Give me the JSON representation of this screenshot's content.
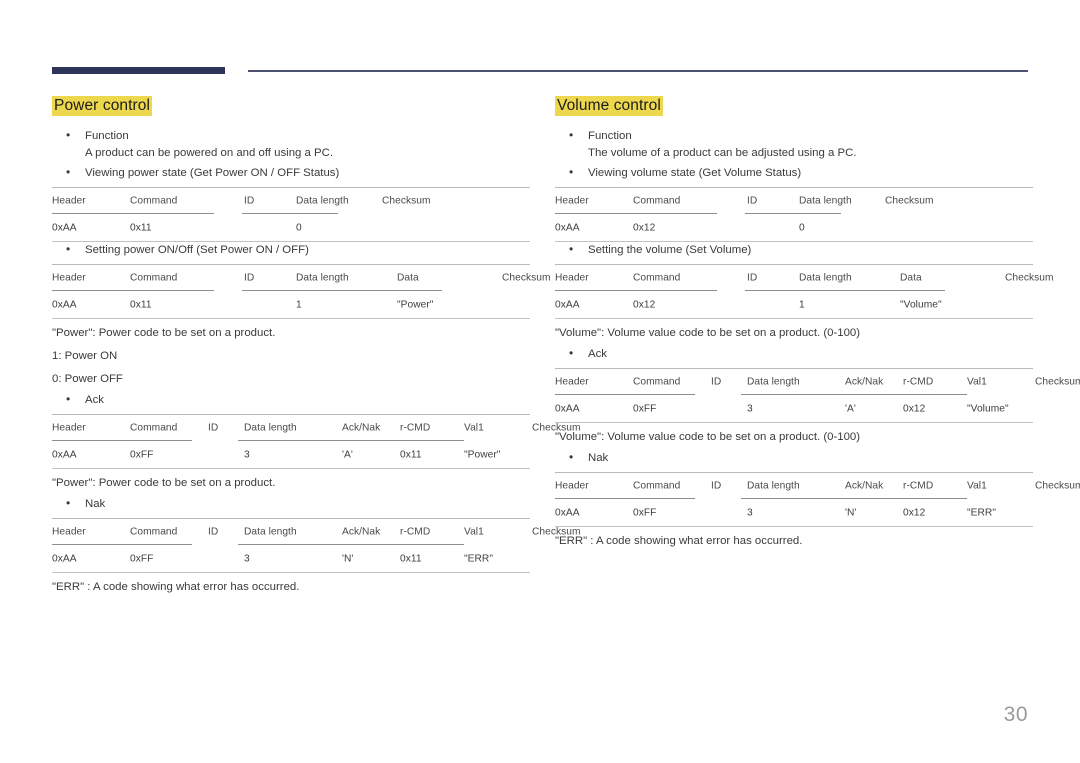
{
  "page": {
    "number": "30",
    "accent_bar_color": "#2c3559",
    "rule_color": "#4e5272",
    "highlight_color": "#edd74c"
  },
  "columns": [
    {
      "id": "power-control",
      "title": "Power control",
      "blocks": [
        {
          "kind": "bullet",
          "label": "Function",
          "sub": "A product can be powered on and off using a PC."
        },
        {
          "kind": "bullet",
          "label": "Viewing power state (Get Power ON / OFF Status)"
        },
        {
          "kind": "table",
          "id": "get-power-status",
          "layout": "get",
          "headers": [
            "Header",
            "Command",
            "ID",
            "Data length",
            "Checksum"
          ],
          "values": [
            "0xAA",
            "0x11",
            "",
            "0",
            ""
          ]
        },
        {
          "kind": "bullet",
          "label": "Setting power ON/Off (Set Power ON / OFF)"
        },
        {
          "kind": "table",
          "id": "set-power",
          "layout": "set",
          "headers": [
            "Header",
            "Command",
            "ID",
            "Data length",
            "Data",
            "Checksum"
          ],
          "values": [
            "0xAA",
            "0x11",
            "",
            "1",
            "\"Power\"",
            ""
          ]
        },
        {
          "kind": "note",
          "text": "\"Power\": Power code to be set on a product."
        },
        {
          "kind": "note",
          "text": "1: Power ON"
        },
        {
          "kind": "note",
          "text": "0: Power OFF"
        },
        {
          "kind": "bullet",
          "label": "Ack"
        },
        {
          "kind": "table",
          "id": "power-ack",
          "layout": "ack",
          "headers": [
            "Header",
            "Command",
            "ID",
            "Data length",
            "Ack/Nak",
            "r-CMD",
            "Val1",
            "Checksum"
          ],
          "values": [
            "0xAA",
            "0xFF",
            "",
            "3",
            "'A'",
            "0x11",
            "\"Power\"",
            ""
          ]
        },
        {
          "kind": "note",
          "text": "\"Power\": Power code to be set on a product."
        },
        {
          "kind": "bullet",
          "label": "Nak"
        },
        {
          "kind": "table",
          "id": "power-nak",
          "layout": "ack",
          "headers": [
            "Header",
            "Command",
            "ID",
            "Data length",
            "Ack/Nak",
            "r-CMD",
            "Val1",
            "Checksum"
          ],
          "values": [
            "0xAA",
            "0xFF",
            "",
            "3",
            "'N'",
            "0x11",
            "\"ERR\"",
            ""
          ]
        },
        {
          "kind": "note",
          "text": "\"ERR\" : A code showing what error has occurred."
        }
      ]
    },
    {
      "id": "volume-control",
      "title": "Volume control",
      "blocks": [
        {
          "kind": "bullet",
          "label": "Function",
          "sub": "The volume of a product can be adjusted using a PC."
        },
        {
          "kind": "bullet",
          "label": "Viewing volume state (Get Volume Status)"
        },
        {
          "kind": "table",
          "id": "get-volume-status",
          "layout": "get",
          "headers": [
            "Header",
            "Command",
            "ID",
            "Data length",
            "Checksum"
          ],
          "values": [
            "0xAA",
            "0x12",
            "",
            "0",
            ""
          ]
        },
        {
          "kind": "bullet",
          "label": "Setting the volume (Set Volume)"
        },
        {
          "kind": "table",
          "id": "set-volume",
          "layout": "set",
          "headers": [
            "Header",
            "Command",
            "ID",
            "Data length",
            "Data",
            "Checksum"
          ],
          "values": [
            "0xAA",
            "0x12",
            "",
            "1",
            "\"Volume\"",
            ""
          ]
        },
        {
          "kind": "note",
          "text": "\"Volume\": Volume value code to be set on a product. (0-100)"
        },
        {
          "kind": "bullet",
          "label": "Ack"
        },
        {
          "kind": "table",
          "id": "volume-ack",
          "layout": "ack",
          "headers": [
            "Header",
            "Command",
            "ID",
            "Data length",
            "Ack/Nak",
            "r-CMD",
            "Val1",
            "Checksum"
          ],
          "values": [
            "0xAA",
            "0xFF",
            "",
            "3",
            "'A'",
            "0x12",
            "\"Volume\"",
            ""
          ]
        },
        {
          "kind": "note",
          "text": "\"Volume\": Volume value code to be set on a product. (0-100)"
        },
        {
          "kind": "bullet",
          "label": "Nak"
        },
        {
          "kind": "table",
          "id": "volume-nak",
          "layout": "ack",
          "headers": [
            "Header",
            "Command",
            "ID",
            "Data length",
            "Ack/Nak",
            "r-CMD",
            "Val1",
            "Checksum"
          ],
          "values": [
            "0xAA",
            "0xFF",
            "",
            "3",
            "'N'",
            "0x12",
            "\"ERR\"",
            ""
          ]
        },
        {
          "kind": "note",
          "text": "\"ERR\" : A code showing what error has occurred."
        }
      ]
    }
  ],
  "layouts": {
    "get": {
      "cols": [
        0,
        78,
        192,
        244,
        330
      ],
      "segments": [
        [
          0,
          162
        ],
        [
          190,
          286
        ]
      ]
    },
    "set": {
      "cols": [
        0,
        78,
        192,
        244,
        345,
        450
      ],
      "segments": [
        [
          0,
          162
        ],
        [
          190,
          390
        ]
      ]
    },
    "ack": {
      "cols": [
        0,
        78,
        156,
        192,
        290,
        348,
        412,
        480
      ],
      "segments": [
        [
          0,
          140
        ],
        [
          186,
          412
        ]
      ]
    }
  }
}
